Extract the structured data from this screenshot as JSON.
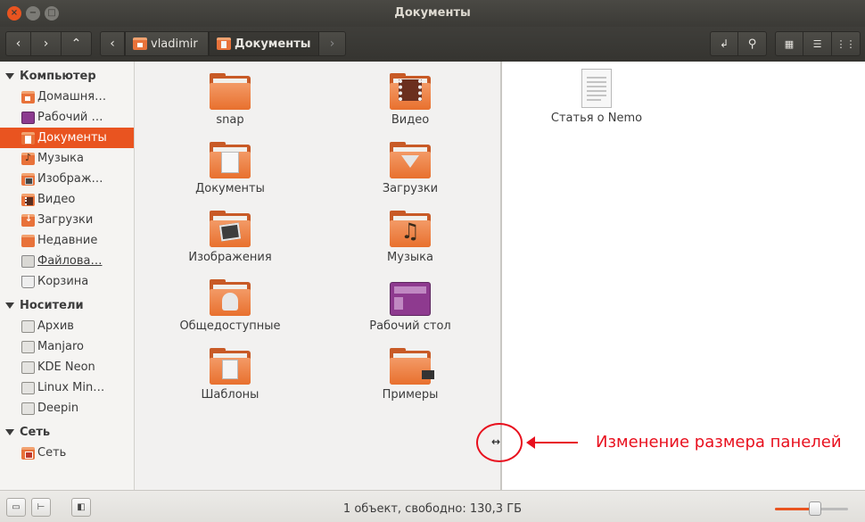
{
  "window": {
    "title": "Документы"
  },
  "toolbar": {
    "breadcrumbs": [
      {
        "label": "vladimir",
        "icon": "home-folder-icon"
      },
      {
        "label": "Документы",
        "icon": "documents-folder-icon"
      }
    ]
  },
  "sidebar": {
    "sections": [
      {
        "title": "Компьютер",
        "items": [
          {
            "label": "Домашня…",
            "icon": "home-folder-icon"
          },
          {
            "label": "Рабочий …",
            "icon": "desktop-icon"
          },
          {
            "label": "Документы",
            "icon": "documents-folder-icon",
            "active": true
          },
          {
            "label": "Музыка",
            "icon": "music-folder-icon"
          },
          {
            "label": "Изображ…",
            "icon": "pictures-folder-icon"
          },
          {
            "label": "Видео",
            "icon": "videos-folder-icon"
          },
          {
            "label": "Загрузки",
            "icon": "downloads-folder-icon"
          },
          {
            "label": "Недавние",
            "icon": "recent-icon"
          },
          {
            "label": "Файлова…",
            "icon": "filesystem-icon"
          },
          {
            "label": "Корзина",
            "icon": "trash-icon"
          }
        ]
      },
      {
        "title": "Носители",
        "items": [
          {
            "label": "Архив",
            "icon": "drive-icon"
          },
          {
            "label": "Manjaro",
            "icon": "drive-icon"
          },
          {
            "label": "KDE Neon",
            "icon": "drive-icon"
          },
          {
            "label": "Linux Min…",
            "icon": "drive-icon"
          },
          {
            "label": "Deepin",
            "icon": "drive-icon"
          }
        ]
      },
      {
        "title": "Сеть",
        "items": [
          {
            "label": "Сеть",
            "icon": "network-icon"
          }
        ]
      }
    ]
  },
  "left_pane": {
    "items": [
      {
        "label": "snap",
        "icon": "folder-icon"
      },
      {
        "label": "Видео",
        "icon": "videos-folder-icon"
      },
      {
        "label": "Документы",
        "icon": "documents-folder-icon"
      },
      {
        "label": "Загрузки",
        "icon": "downloads-folder-icon"
      },
      {
        "label": "Изображения",
        "icon": "pictures-folder-icon"
      },
      {
        "label": "Музыка",
        "icon": "music-folder-icon"
      },
      {
        "label": "Общедоступные",
        "icon": "public-folder-icon"
      },
      {
        "label": "Рабочий стол",
        "icon": "desktop-folder-icon"
      },
      {
        "label": "Шаблоны",
        "icon": "templates-folder-icon"
      },
      {
        "label": "Примеры",
        "icon": "examples-folder-icon"
      }
    ]
  },
  "right_pane": {
    "items": [
      {
        "label": "Статья о Nemo",
        "icon": "text-document-icon"
      }
    ]
  },
  "annotation": {
    "text": "Изменение размера панелей",
    "color": "#e8101e"
  },
  "statusbar": {
    "text": "1 объект, свободно: 130,3 ГБ",
    "zoom_level": 0.55
  },
  "colors": {
    "accent": "#e95420",
    "titlebar": "#3b3a36"
  }
}
